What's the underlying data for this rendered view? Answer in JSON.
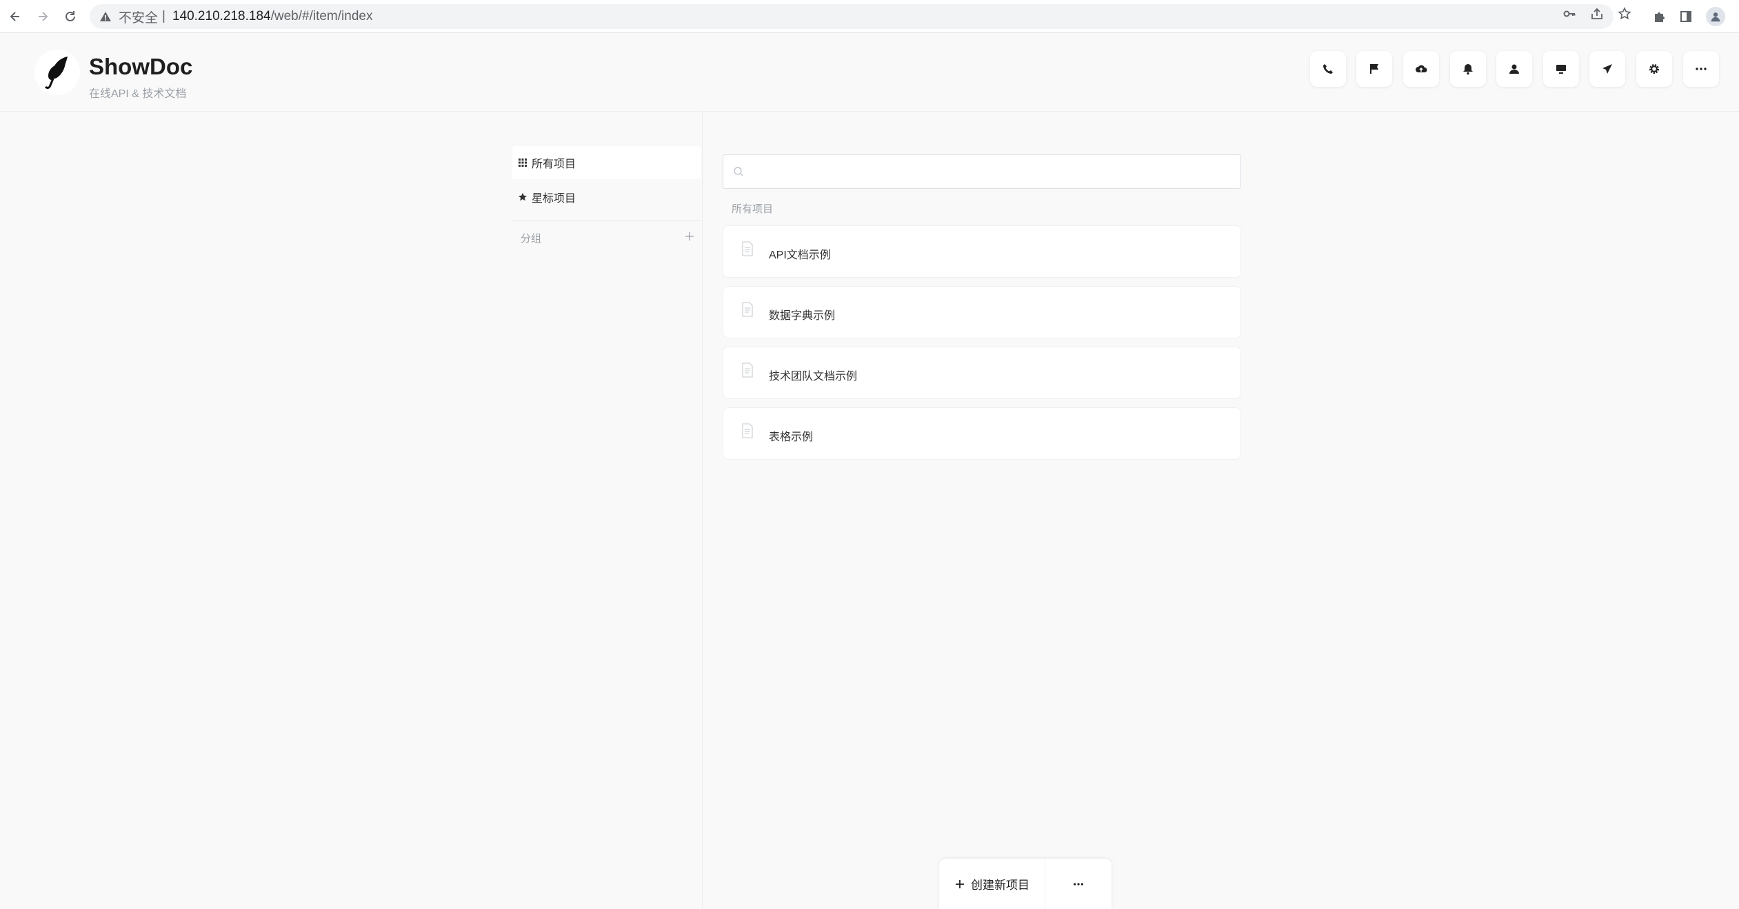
{
  "browser": {
    "insecure_label": "不安全",
    "separator": "|",
    "url_host": "140.210.218.184",
    "url_path": "/web/#/item/index"
  },
  "header": {
    "title": "ShowDoc",
    "subtitle": "在线API & 技术文档",
    "icons": [
      "phone-icon",
      "flag-icon",
      "cloud-upload-icon",
      "bell-icon",
      "user-icon",
      "monitor-icon",
      "send-icon",
      "gear-icon",
      "more-icon"
    ]
  },
  "sidebar": {
    "items": [
      {
        "label": "所有项目",
        "icon": "grid-icon",
        "active": true
      },
      {
        "label": "星标项目",
        "icon": "star-icon",
        "active": false
      }
    ],
    "group_label": "分组",
    "group_add": "+"
  },
  "main": {
    "search_placeholder": "",
    "section_label": "所有项目",
    "projects": [
      {
        "name": "API文档示例",
        "icon": "document-icon"
      },
      {
        "name": "数据字典示例",
        "icon": "document-icon"
      },
      {
        "name": "技术团队文档示例",
        "icon": "document-icon"
      },
      {
        "name": "表格示例",
        "icon": "document-icon"
      }
    ]
  },
  "actions": {
    "create_label": "创建新项目",
    "more_label": "···"
  },
  "colors": {
    "page_bg": "#f9f9f9",
    "card_bg": "#ffffff",
    "text": "#303133",
    "muted": "#9aa0a6"
  }
}
